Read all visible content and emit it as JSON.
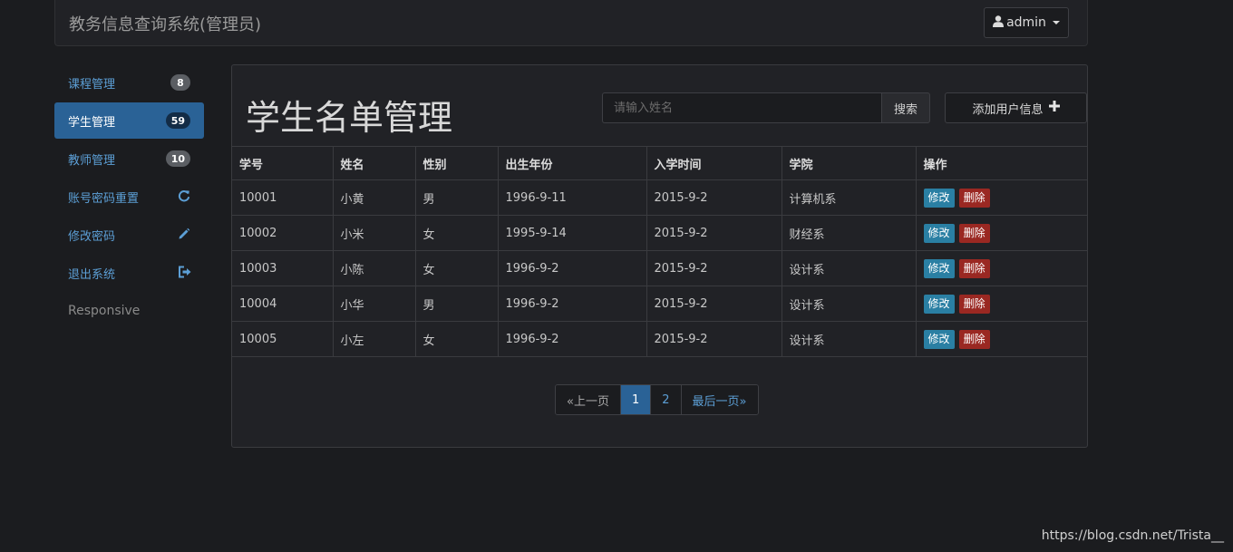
{
  "header": {
    "title": "教务信息查询系统(管理员)",
    "user_label": "admin"
  },
  "sidebar": {
    "items": [
      {
        "label": "课程管理",
        "badge": "8"
      },
      {
        "label": "学生管理",
        "badge": "59"
      },
      {
        "label": "教师管理",
        "badge": "10"
      },
      {
        "label": "账号密码重置",
        "icon": "refresh-icon"
      },
      {
        "label": "修改密码",
        "icon": "pencil-icon"
      },
      {
        "label": "退出系统",
        "icon": "logout-icon"
      },
      {
        "label": "Responsive"
      }
    ],
    "active_index": 1
  },
  "main": {
    "title": "学生名单管理",
    "search": {
      "placeholder": "请输入姓名",
      "value": "",
      "button_label": "搜索"
    },
    "add_button_label": "添加用户信息"
  },
  "table": {
    "headers": [
      "学号",
      "姓名",
      "性别",
      "出生年份",
      "入学时间",
      "学院",
      "操作"
    ],
    "rows": [
      [
        "10001",
        "小黄",
        "男",
        "1996-9-11",
        "2015-9-2",
        "计算机系"
      ],
      [
        "10002",
        "小米",
        "女",
        "1995-9-14",
        "2015-9-2",
        "财经系"
      ],
      [
        "10003",
        "小陈",
        "女",
        "1996-9-2",
        "2015-9-2",
        "设计系"
      ],
      [
        "10004",
        "小华",
        "男",
        "1996-9-2",
        "2015-9-2",
        "设计系"
      ],
      [
        "10005",
        "小左",
        "女",
        "1996-9-2",
        "2015-9-2",
        "设计系"
      ]
    ],
    "edit_label": "修改",
    "delete_label": "删除"
  },
  "pagination": {
    "prev_label": "«上一页",
    "pages": [
      "1",
      "2"
    ],
    "current_page": "1",
    "last_label": "最后一页»"
  },
  "watermark": "https://blog.csdn.net/Trista__",
  "colors": {
    "background": "#1b1c1f",
    "panel": "#212226",
    "accent": "#2a6296",
    "link": "#5c9fd6",
    "edit_button": "#2a7fa3",
    "delete_button": "#9a2822"
  }
}
